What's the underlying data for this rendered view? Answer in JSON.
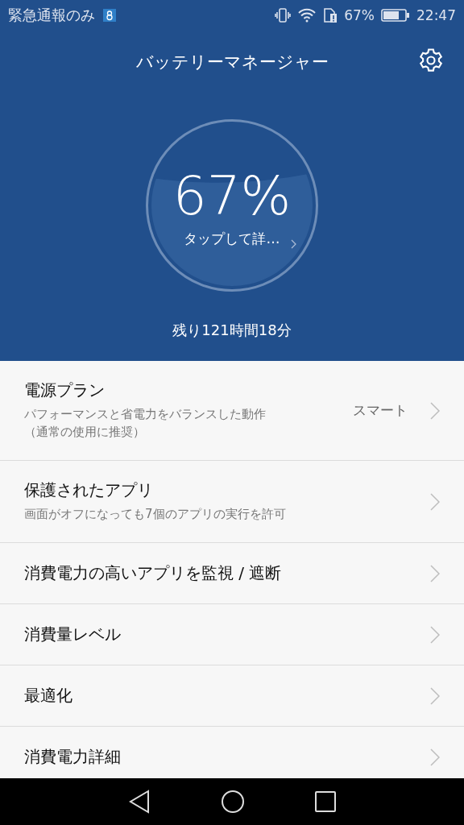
{
  "status_bar": {
    "carrier": "緊急通報のみ",
    "battery_text": "67%",
    "time": "22:47"
  },
  "header": {
    "title": "バッテリーマネージャー"
  },
  "gauge": {
    "percent": "67%",
    "hint": "タップして詳…",
    "remaining": "残り121時間18分"
  },
  "items": [
    {
      "title": "電源プラン",
      "subtitle": "パフォーマンスと省電力をバランスした動作（通常の使用に推奨）",
      "value": "スマート"
    },
    {
      "title": "保護されたアプリ",
      "subtitle": "画面がオフになっても7個のアプリの実行を許可"
    },
    {
      "title": "消費電力の高いアプリを監視 / 遮断"
    },
    {
      "title": "消費量レベル"
    },
    {
      "title": "最適化"
    },
    {
      "title": "消費電力詳細"
    }
  ]
}
